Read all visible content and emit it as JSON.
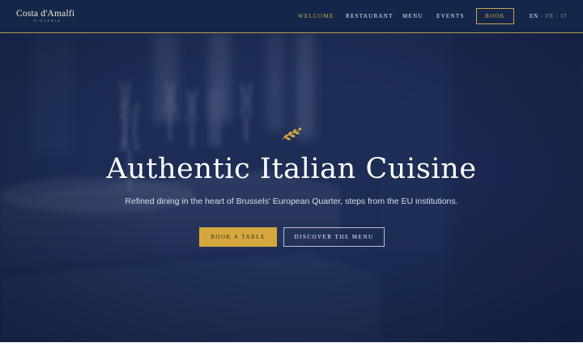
{
  "header": {
    "logo": {
      "name": "Costa d'Amalfi",
      "subtitle": "PIZZERIA"
    },
    "nav": [
      {
        "label": "WELCOME",
        "active": true
      },
      {
        "label": "RESTAURANT",
        "active": false
      },
      {
        "label": "MENU",
        "active": false
      },
      {
        "label": "EVENTS",
        "active": false
      }
    ],
    "book_label": "BOOK",
    "languages": [
      {
        "code": "EN",
        "active": true
      },
      {
        "code": "FR",
        "active": false
      },
      {
        "code": "IT",
        "active": false
      }
    ],
    "language_separator": "/"
  },
  "hero": {
    "ornament_icon": "olive-branch-icon",
    "title": "Authentic Italian Cuisine",
    "subtitle": "Refined dining in the heart of Brussels' European Quarter, steps from the EU institutions.",
    "primary_button": "BOOK A TABLE",
    "secondary_button": "DISCOVER THE MENU"
  },
  "colors": {
    "header_bg": "#14274a",
    "accent_gold": "#d6a73c",
    "hero_overlay": "#1c2c52"
  }
}
